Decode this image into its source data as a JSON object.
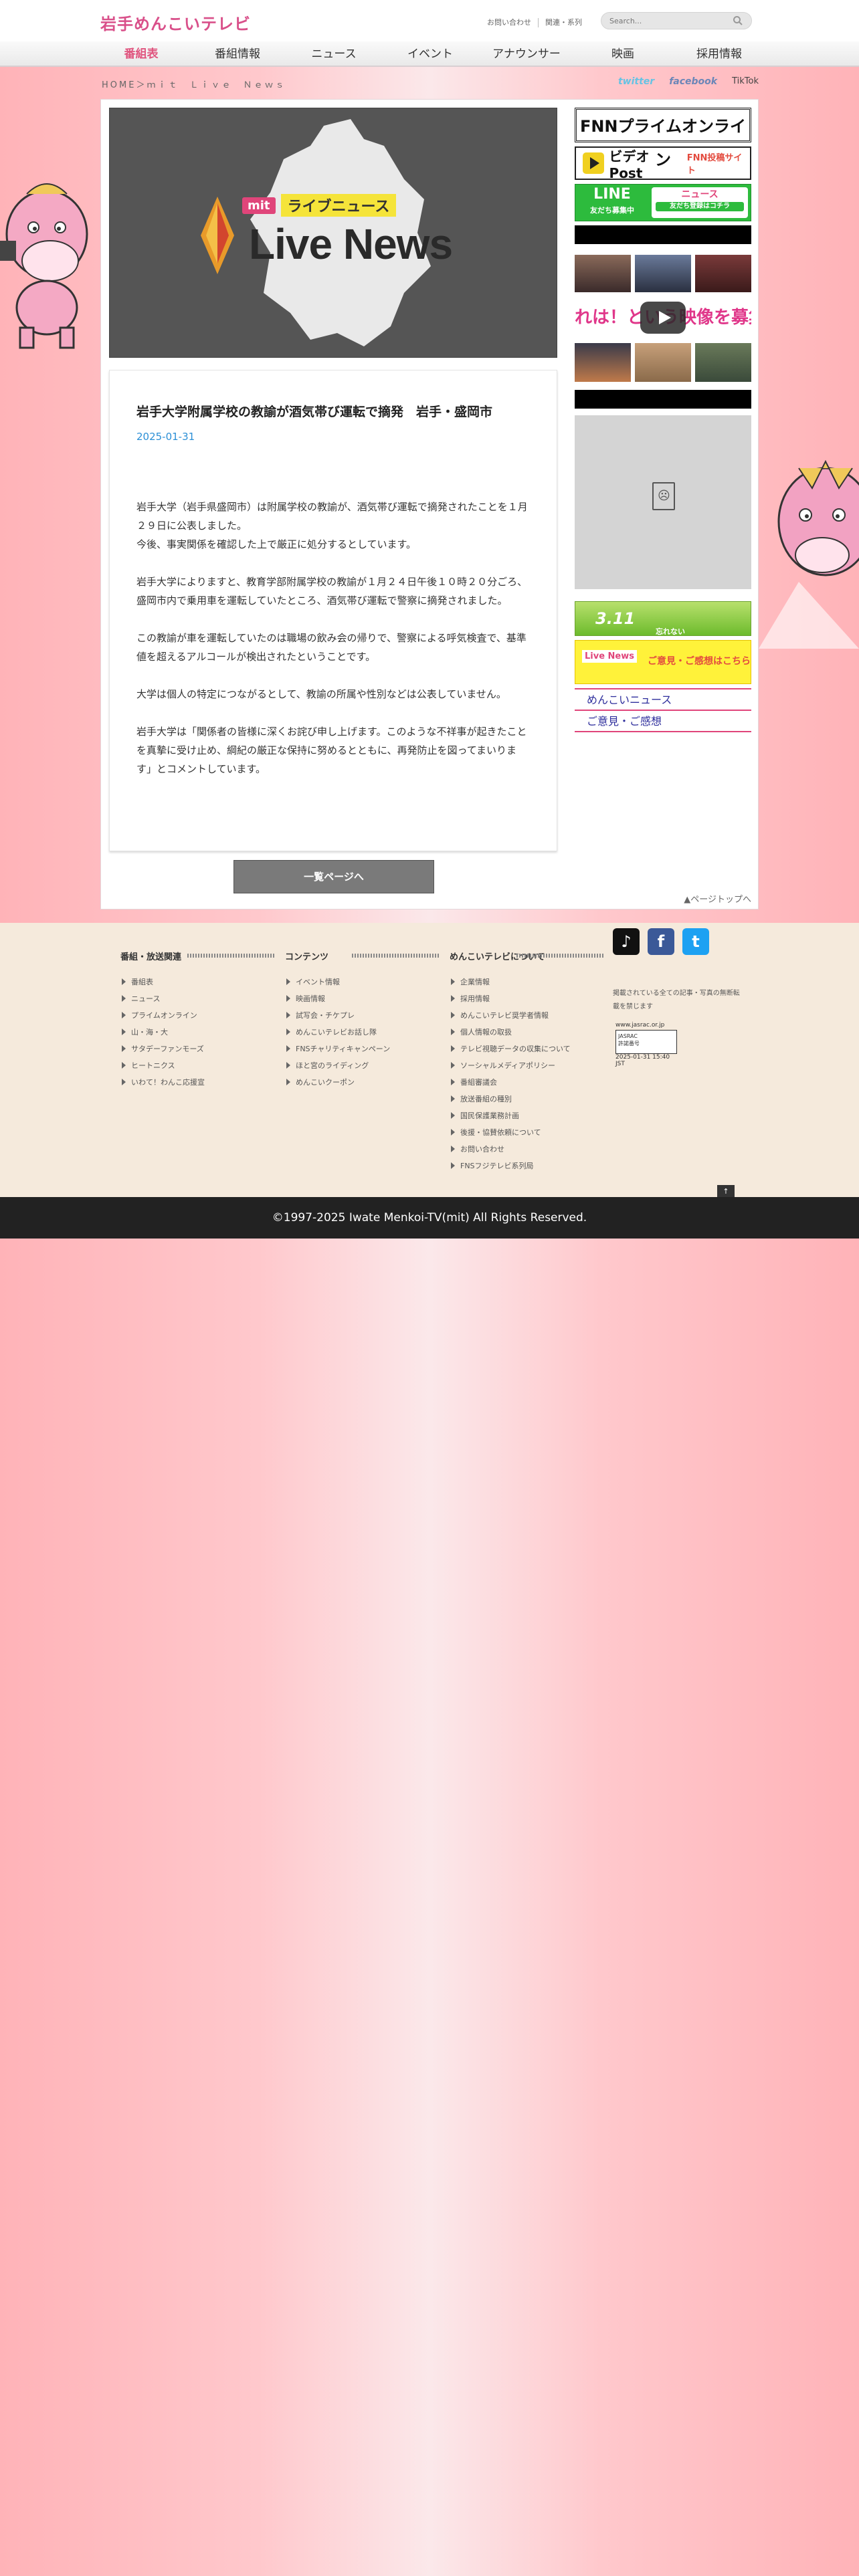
{
  "header": {
    "logo": "岩手めんこいテレビ",
    "links": [
      "お問い合わせ",
      "関連・系列"
    ],
    "search_placeholder": "Search..."
  },
  "nav": [
    "番組表",
    "番組情報",
    "ニュース",
    "イベント",
    "アナウンサー",
    "映画",
    "採用情報"
  ],
  "breadcrumb": "HOME＞ｍｉｔ　Ｌｉｖｅ　Ｎｅｗｓ",
  "social_top": [
    "twitter",
    "facebook",
    "TikTok"
  ],
  "hero": {
    "badge_mit": "mit",
    "badge_live": "ライブニュース",
    "title_en": "Live News"
  },
  "article": {
    "title": "岩手大学附属学校の教諭が酒気帯び運転で摘発　岩手・盛岡市",
    "date": "2025-01-31",
    "paragraphs": [
      "岩手大学（岩手県盛岡市）は附属学校の教諭が、酒気帯び運転で摘発されたことを１月２９日に公表しました。\n今後、事実関係を確認した上で厳正に処分するとしています。",
      "岩手大学によりますと、教育学部附属学校の教諭が１月２４日午後１０時２０分ごろ、盛岡市内で乗用車を運転していたところ、酒気帯び運転で警察に摘発されました。",
      "この教諭が車を運転していたのは職場の飲み会の帰りで、警察による呼気検査で、基準値を超えるアルコールが検出されたということです。",
      "大学は個人の特定につながるとして、教諭の所属や性別などは公表していません。",
      "岩手大学は「関係者の皆様に深くお詫び申し上げます。このような不祥事が起きたことを真摯に受け止め、綱紀の厳正な保持に努めるとともに、再発防止を図ってまいります」とコメントしています。"
    ]
  },
  "more_button": "一覧ページへ",
  "pagetop": "▲ページトップへ",
  "sidebar": {
    "fnn": "FNNプライムオンライン",
    "video_post": "ビデオPost",
    "video_post_sub": "FNN投稿サイト",
    "line_main": "LINE",
    "line_sub": "友だち募集中",
    "line_right": "ニュース",
    "line_right_sub": "友だち登録はコチラ",
    "video_banner": "れは！という映像を募集中",
    "banner_311": "3.11",
    "banner_311_sub": "忘れない",
    "opinion_live": "Live News",
    "opinion_ask": "ご意見・ご感想はこちら",
    "links": [
      "めんこいニュース",
      "ご意見・ご感想"
    ]
  },
  "footer": {
    "col1": {
      "title": "番組・放送関連",
      "items": [
        "番組表",
        "ニュース",
        "プライムオンライン",
        "山・海・大",
        "サタデーファンモーズ",
        "ヒートニクス",
        "いわて！わんこ応援宣"
      ]
    },
    "col2": {
      "title": "コンテンツ",
      "items": [
        "イベント情報",
        "映画情報",
        "試写会・チケプレ",
        "めんこいテレビお話し隊",
        "FNSチャリティキャンペーン",
        "ほと宮のライディング",
        "めんこいクーポン"
      ]
    },
    "col3": {
      "title": "めんこいテレビについて",
      "items": [
        "企業情報",
        "採用情報",
        "めんこいテレビ奨学者情報",
        "個人情報の取扱",
        "テレビ視聴データの収集について",
        "ソーシャルメディアポリシー",
        "番組審議会",
        "放送番組の種別",
        "国民保護業務計画",
        "後援・協賛依頼について",
        "お問い合わせ",
        "FNSフジテレビ系列局"
      ]
    },
    "note": "掲載されている全ての記事・写真の無断転載を禁じます",
    "cert_url": "www.jasrac.or.jp",
    "cert_date": "2025-01-31 15:40 JST"
  },
  "copyright": "©1997-2025 Iwate Menkoi-TV(mit) All Rights Reserved."
}
